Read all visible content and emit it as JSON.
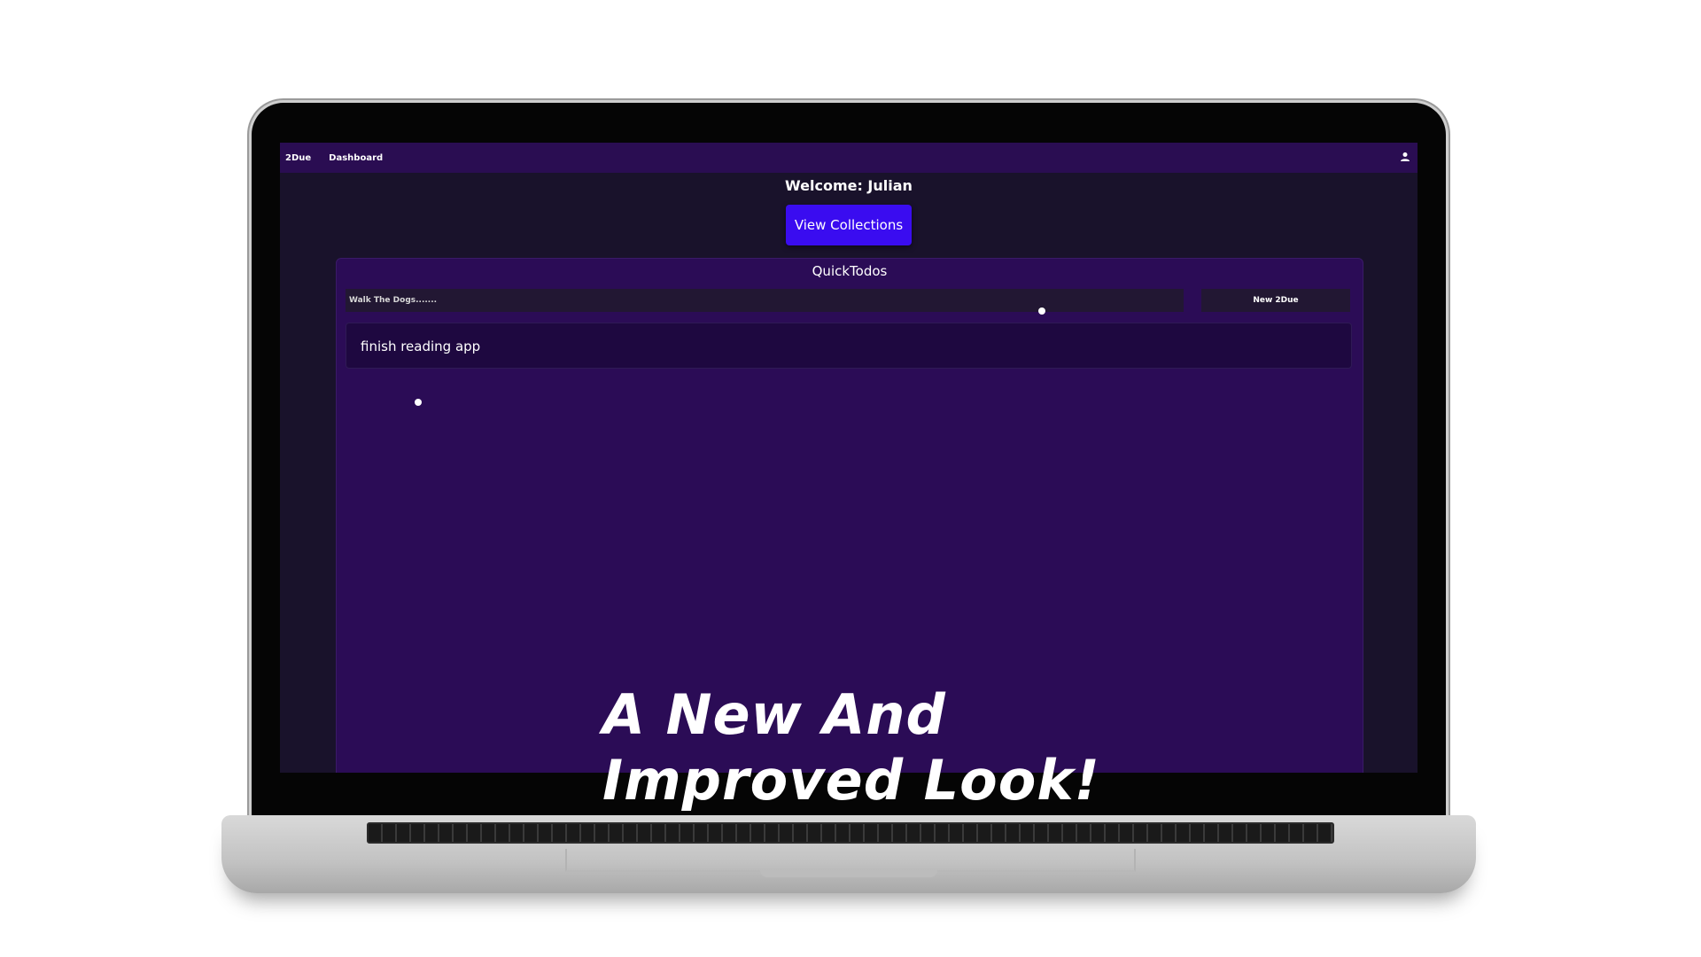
{
  "navbar": {
    "brand": "2Due",
    "dashboard": "Dashboard",
    "user_icon": "user-icon"
  },
  "main": {
    "welcome": "Welcome: Julian",
    "view_collections": "View Collections"
  },
  "quicktodos": {
    "title": "QuickTodos",
    "input_placeholder": "Walk The Dogs.......",
    "new_button": "New 2Due",
    "items": [
      {
        "label": "finish reading app"
      }
    ]
  },
  "overlay": {
    "line1": "A New And",
    "line2": "Improved Look!"
  },
  "colors": {
    "navbar_bg": "#2a0d52",
    "page_bg": "#19122b",
    "panel_bg": "#2b0c56",
    "button_accent": "#3a0cf0"
  }
}
